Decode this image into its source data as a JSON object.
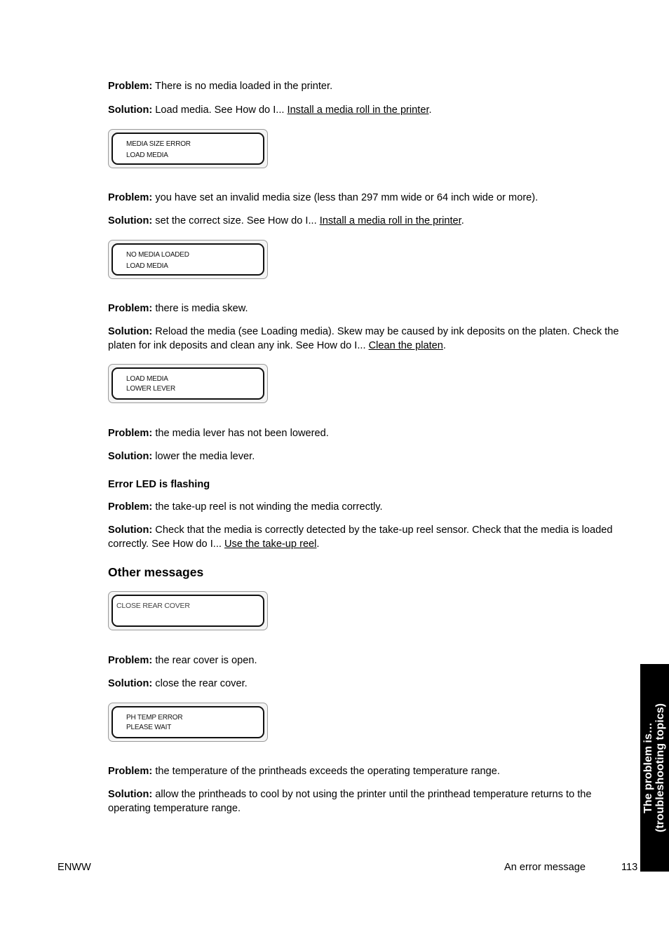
{
  "labels": {
    "problem": "Problem:",
    "solution": "Solution:"
  },
  "sections": [
    {
      "problem": "There is no media loaded in the printer.",
      "solution_pre": "Load media. See How do I... ",
      "solution_link": "Install a media roll in the printer",
      "solution_post": "."
    },
    {
      "lcd": [
        "MEDIA SIZE ERROR",
        "LOAD MEDIA"
      ],
      "problem": "you have set an invalid media size (less than 297 mm wide or 64 inch wide or more).",
      "solution_pre": "set the correct size. See How do I... ",
      "solution_link": "Install a media roll in the printer",
      "solution_post": "."
    },
    {
      "lcd": [
        "NO MEDIA LOADED",
        "LOAD MEDIA"
      ],
      "problem": "there is media skew.",
      "solution_pre": "Reload the media (see Loading media). Skew may be caused by ink deposits on the platen. Check the platen for ink deposits and clean any ink. See How do I... ",
      "solution_link": "Clean the platen",
      "solution_post": "."
    },
    {
      "lcd": [
        "LOAD MEDIA",
        "LOWER LEVER"
      ],
      "problem": "the media lever has not been lowered.",
      "solution": "lower the media lever."
    }
  ],
  "error_led": {
    "heading": "Error LED is flashing",
    "problem": "the take-up reel is not winding the media correctly.",
    "solution_pre": "Check that the media is correctly detected by the take-up reel sensor. Check that the media is loaded correctly. See How do I... ",
    "solution_link": "Use the take-up reel",
    "solution_post": "."
  },
  "other_messages": {
    "heading": "Other messages",
    "items": [
      {
        "lcd": [
          "CLOSE REAR COVER"
        ],
        "problem": "the rear cover is open.",
        "solution": "close the rear cover."
      },
      {
        "lcd": [
          "PH TEMP ERROR",
          "PLEASE WAIT"
        ],
        "problem": "the temperature of the printheads exceeds the operating temperature range.",
        "solution": "allow the printheads to cool by not using the printer until the printhead temperature returns to the operating temperature range."
      }
    ]
  },
  "side_tab": {
    "line1": "The problem is…",
    "line2": "(troubleshooting topics)"
  },
  "footer": {
    "left": "ENWW",
    "section": "An error message",
    "page": "113"
  }
}
